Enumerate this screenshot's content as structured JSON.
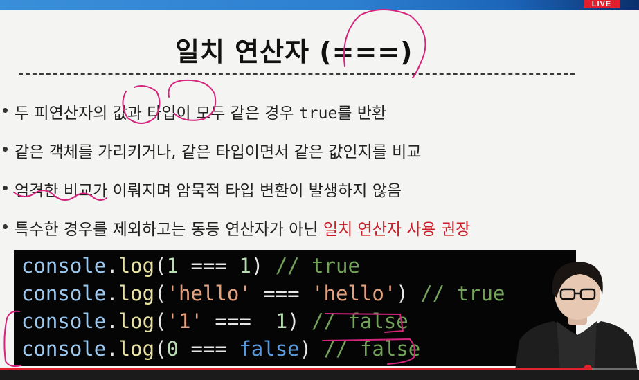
{
  "live_badge": "LIVE",
  "slide": {
    "title": "일치 연산자 (===)",
    "bullets": [
      {
        "parts": [
          {
            "text": "두 피연산자의 값과 타입이 모두 같은 경우 ",
            "style": "normal"
          },
          {
            "text": "true",
            "style": "mono"
          },
          {
            "text": "를 반환",
            "style": "normal"
          }
        ]
      },
      {
        "parts": [
          {
            "text": "같은 객체를 가리키거나, 같은 타입이면서 같은 값인지를 비교",
            "style": "normal"
          }
        ]
      },
      {
        "parts": [
          {
            "text": "엄격한 비교가 이뤄지며 암묵적 타입 변환이 발생하지 않음",
            "style": "normal"
          }
        ]
      },
      {
        "parts": [
          {
            "text": "특수한 경우를 제외하고는 동등 연산자가 아닌 ",
            "style": "normal"
          },
          {
            "text": "일치 연산자 사용 권장",
            "style": "accent"
          }
        ]
      }
    ],
    "code_lines": [
      [
        {
          "t": "console",
          "k": "ident"
        },
        {
          "t": ".",
          "k": "punc"
        },
        {
          "t": "log",
          "k": "func"
        },
        {
          "t": "(",
          "k": "punc"
        },
        {
          "t": "1",
          "k": "num"
        },
        {
          "t": " === ",
          "k": "op"
        },
        {
          "t": "1",
          "k": "num"
        },
        {
          "t": ") ",
          "k": "punc"
        },
        {
          "t": "// true",
          "k": "comment"
        }
      ],
      [
        {
          "t": "console",
          "k": "ident"
        },
        {
          "t": ".",
          "k": "punc"
        },
        {
          "t": "log",
          "k": "func"
        },
        {
          "t": "(",
          "k": "punc"
        },
        {
          "t": "'hello'",
          "k": "str"
        },
        {
          "t": " === ",
          "k": "op"
        },
        {
          "t": "'hello'",
          "k": "str"
        },
        {
          "t": ") ",
          "k": "punc"
        },
        {
          "t": "// true",
          "k": "comment"
        }
      ],
      [
        {
          "t": "console",
          "k": "ident"
        },
        {
          "t": ".",
          "k": "punc"
        },
        {
          "t": "log",
          "k": "func"
        },
        {
          "t": "(",
          "k": "punc"
        },
        {
          "t": "'1'",
          "k": "str"
        },
        {
          "t": " ===  ",
          "k": "op"
        },
        {
          "t": "1",
          "k": "num"
        },
        {
          "t": ") ",
          "k": "punc"
        },
        {
          "t": "// false",
          "k": "comment"
        }
      ],
      [
        {
          "t": "console",
          "k": "ident"
        },
        {
          "t": ".",
          "k": "punc"
        },
        {
          "t": "log",
          "k": "func"
        },
        {
          "t": "(",
          "k": "punc"
        },
        {
          "t": "0",
          "k": "num"
        },
        {
          "t": " === ",
          "k": "op"
        },
        {
          "t": "false",
          "k": "kw"
        },
        {
          "t": ") ",
          "k": "punc"
        },
        {
          "t": "// false",
          "k": "comment"
        }
      ]
    ]
  },
  "video": {
    "progress_fraction": 0.92
  },
  "colors": {
    "accent_red": "#c8202a",
    "annotation_pen": "#d6247c",
    "code_background": "#050505",
    "progress_red": "#e4222b"
  }
}
